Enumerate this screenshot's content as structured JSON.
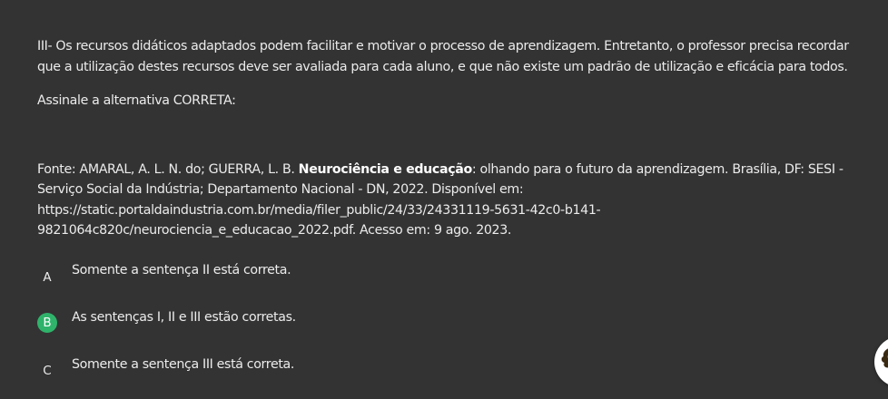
{
  "question": {
    "statement_iii": "III- Os recursos didáticos adaptados podem facilitar e motivar o processo de aprendizagem. Entretanto, o professor precisa recordar que a utilização destes recursos deve ser avaliada para cada aluno, e que não existe um padrão de utilização e eficácia para todos.",
    "prompt": "Assinale a alternativa CORRETA:",
    "source": {
      "prefix": "Fonte: AMARAL, A. L. N. do; GUERRA, L. B. ",
      "book_title": "Neurociência e educação",
      "suffix": ": olhando para o futuro da aprendizagem. Brasília, DF: SESI - Serviço Social da Indústria; Departamento Nacional - DN, 2022. Disponível em: https://static.portaldaindustria.com.br/media/filer_public/24/33/24331119-5631-42c0-b141-9821064c820c/neurociencia_e_educacao_2022.pdf. Acesso em: 9 ago. 2023."
    }
  },
  "options": [
    {
      "letter": "A",
      "text": "Somente a sentença II está correta.",
      "correct": false
    },
    {
      "letter": "B",
      "text": "As sentenças I, II e III estão corretas.",
      "correct": true
    },
    {
      "letter": "C",
      "text": "Somente a sentença III está correta.",
      "correct": false
    }
  ],
  "colors": {
    "background": "#333333",
    "text": "#ececec",
    "correct_badge": "#2fb36b"
  },
  "icons": {
    "floating_button": "assistant-mascot-icon"
  }
}
